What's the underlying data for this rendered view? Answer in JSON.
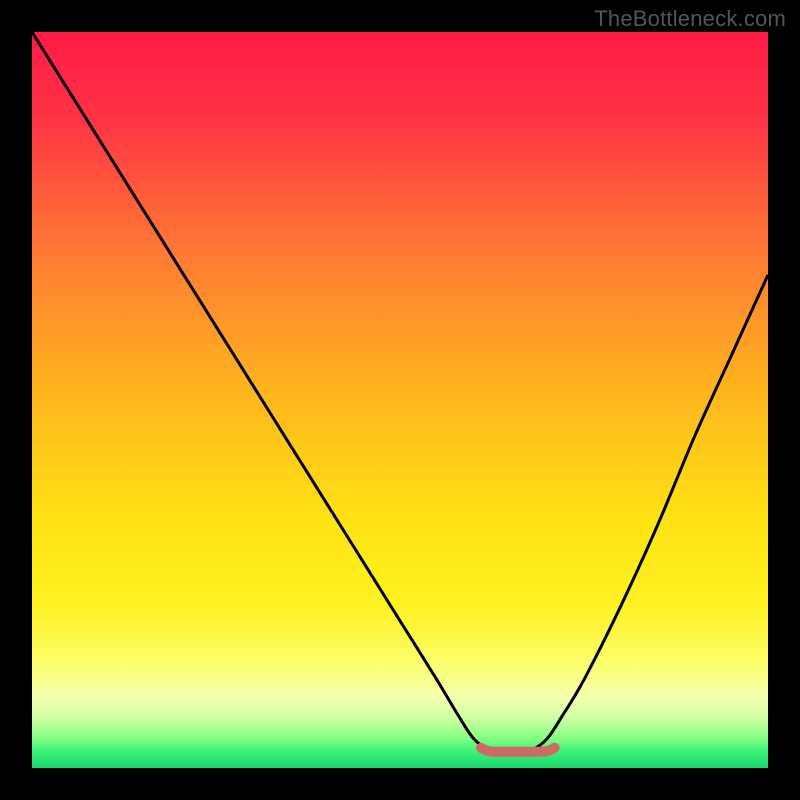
{
  "watermark": "TheBottleneck.com",
  "colors": {
    "frame": "#000000",
    "curve": "#000000",
    "flat_segment": "#cf6a63",
    "gradient_stops": [
      {
        "offset": 0.0,
        "color": "#ff1a47"
      },
      {
        "offset": 0.12,
        "color": "#ff3444"
      },
      {
        "offset": 0.3,
        "color": "#ff7a33"
      },
      {
        "offset": 0.48,
        "color": "#ffb21f"
      },
      {
        "offset": 0.66,
        "color": "#ffe213"
      },
      {
        "offset": 0.78,
        "color": "#fff221"
      },
      {
        "offset": 0.86,
        "color": "#fbff6e"
      },
      {
        "offset": 0.905,
        "color": "#f4ffb0"
      },
      {
        "offset": 0.935,
        "color": "#c8ffa0"
      },
      {
        "offset": 0.96,
        "color": "#82ff82"
      },
      {
        "offset": 0.978,
        "color": "#3cf07a"
      },
      {
        "offset": 1.0,
        "color": "#16d76a"
      }
    ]
  },
  "chart_data": {
    "type": "line",
    "title": "",
    "xlabel": "",
    "ylabel": "",
    "xlim": [
      0,
      100
    ],
    "ylim": [
      0,
      100
    ],
    "categories_note": "x is normalized horizontal position 0–100; y is normalized height 0 at bottom to 100 at top",
    "series": [
      {
        "name": "bottleneck-curve",
        "x": [
          0,
          5,
          10,
          15,
          20,
          25,
          30,
          35,
          40,
          45,
          50,
          55,
          58,
          60,
          62,
          64,
          66,
          68,
          70,
          72,
          75,
          80,
          85,
          90,
          95,
          100
        ],
        "y": [
          100,
          92,
          84,
          76,
          68,
          60,
          52,
          44,
          36,
          28,
          20,
          12,
          7,
          4,
          2.5,
          2.2,
          2.2,
          2.5,
          4,
          7,
          12,
          22,
          33,
          45,
          56,
          67
        ]
      }
    ],
    "annotations": [
      {
        "name": "optimal-flat-segment",
        "x_start": 61,
        "x_end": 71,
        "y": 2.2,
        "color": "#cf6a63"
      }
    ]
  }
}
